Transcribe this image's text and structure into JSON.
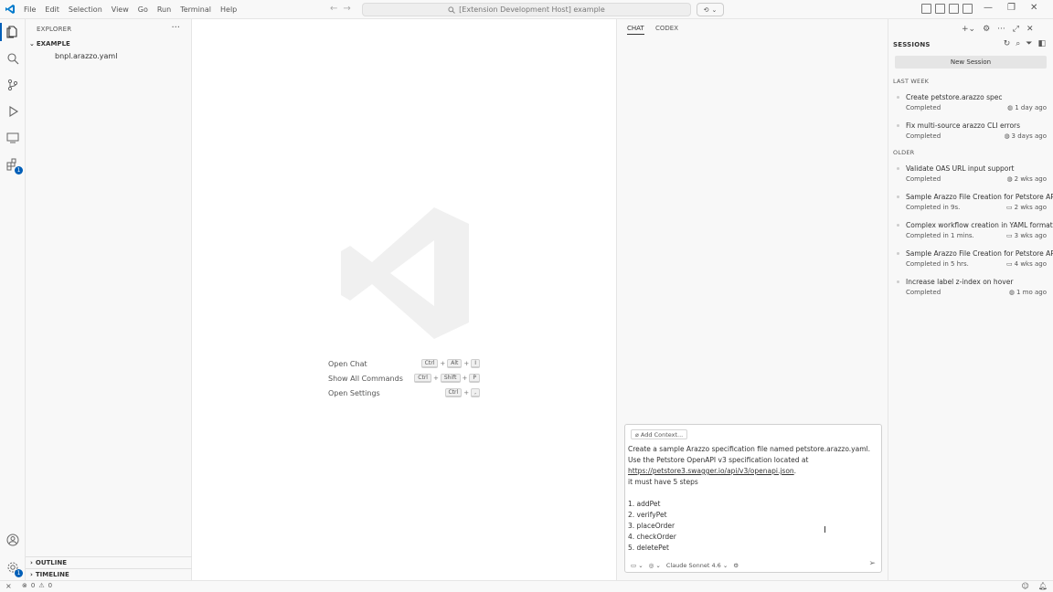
{
  "titlebar": {
    "menu": [
      "File",
      "Edit",
      "Selection",
      "View",
      "Go",
      "Run",
      "Terminal",
      "Help"
    ],
    "command_center": "[Extension Development Host] example"
  },
  "sidebar": {
    "title": "EXPLORER",
    "section": "EXAMPLE",
    "files": [
      "bnpl.arazzo.yaml"
    ],
    "outline": "OUTLINE",
    "timeline": "TIMELINE"
  },
  "activity": {
    "extensions_badge": "1",
    "settings_badge": "1"
  },
  "editor": {
    "shortcuts": [
      {
        "label": "Open Chat",
        "keys": [
          "Ctrl",
          "Alt",
          "I"
        ]
      },
      {
        "label": "Show All Commands",
        "keys": [
          "Ctrl",
          "Shift",
          "P"
        ]
      },
      {
        "label": "Open Settings",
        "keys": [
          "Ctrl",
          ","
        ]
      }
    ]
  },
  "chat": {
    "tabs": [
      "CHAT",
      "CODEX"
    ],
    "add_context": "Add Context...",
    "prompt_line1": "Create a sample Arazzo specification file named petstore.arazzo.yaml. Use the Petstore OpenAPI v3 specification located at",
    "prompt_link": "https://petstore3.swagger.io/api/v3/openapi.json",
    "prompt_line2": "it must have 5 steps",
    "steps": [
      "1. addPet",
      "2. verifyPet",
      "3. placeOrder",
      "4. checkOrder",
      "5. deletePet"
    ],
    "model": "Claude Sonnet 4.6"
  },
  "sessions": {
    "title": "SESSIONS",
    "new_session": "New Session",
    "groups": [
      {
        "label": "LAST WEEK",
        "items": [
          {
            "name": "Create petstore.arazzo spec",
            "status": "Completed",
            "time": "1 day ago"
          },
          {
            "name": "Fix multi-source arazzo CLI errors",
            "status": "Completed",
            "time": "3 days ago"
          }
        ]
      },
      {
        "label": "OLDER",
        "items": [
          {
            "name": "Validate OAS URL input support",
            "status": "Completed",
            "time": "2 wks ago"
          },
          {
            "name": "Sample Arazzo File Creation for Petstore API",
            "status": "Completed in 9s.",
            "time": "2 wks ago"
          },
          {
            "name": "Complex workflow creation in YAML format",
            "status": "Completed in 1 mins.",
            "time": "3 wks ago"
          },
          {
            "name": "Sample Arazzo File Creation for Petstore API",
            "status": "Completed in 5 hrs.",
            "time": "4 wks ago"
          },
          {
            "name": "Increase label z-index on hover",
            "status": "Completed",
            "time": "1 mo ago"
          }
        ]
      }
    ]
  },
  "statusbar": {
    "errors": "0",
    "warnings": "0"
  }
}
